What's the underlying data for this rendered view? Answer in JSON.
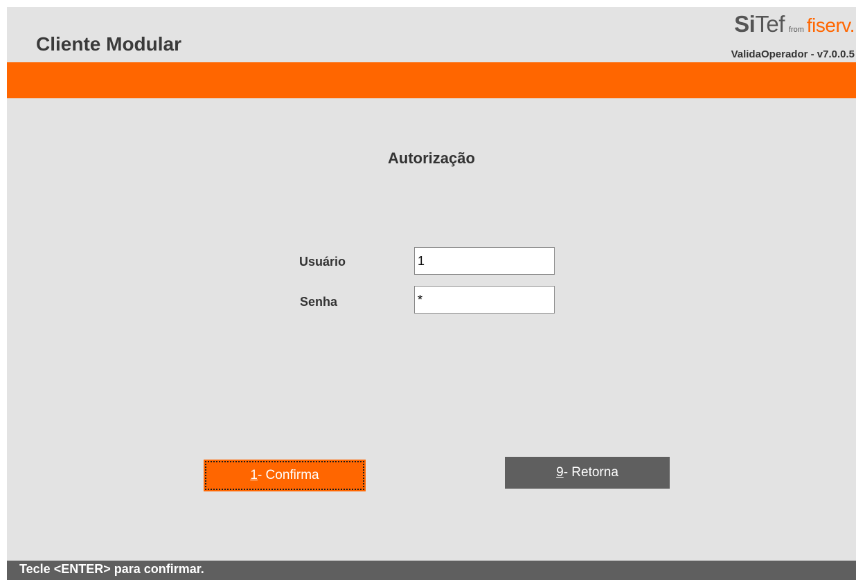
{
  "header": {
    "app_title": "Cliente Modular",
    "logo": {
      "sitef_bold": "Si",
      "sitef_thin": "Tef",
      "from": "from",
      "fiserv": "fiserv."
    },
    "version": "ValidaOperador - v7.0.0.5",
    "accent_color": "#ff6600"
  },
  "form": {
    "title": "Autorização",
    "fields": [
      {
        "label": "Usuário",
        "value": "1"
      },
      {
        "label": "Senha",
        "value": "*"
      }
    ]
  },
  "buttons": {
    "confirm": {
      "key": "1",
      "label": " - Confirma"
    },
    "return": {
      "key": "9",
      "label": " - Retorna"
    }
  },
  "status_bar": {
    "message": "Tecle <ENTER> para confirmar."
  }
}
